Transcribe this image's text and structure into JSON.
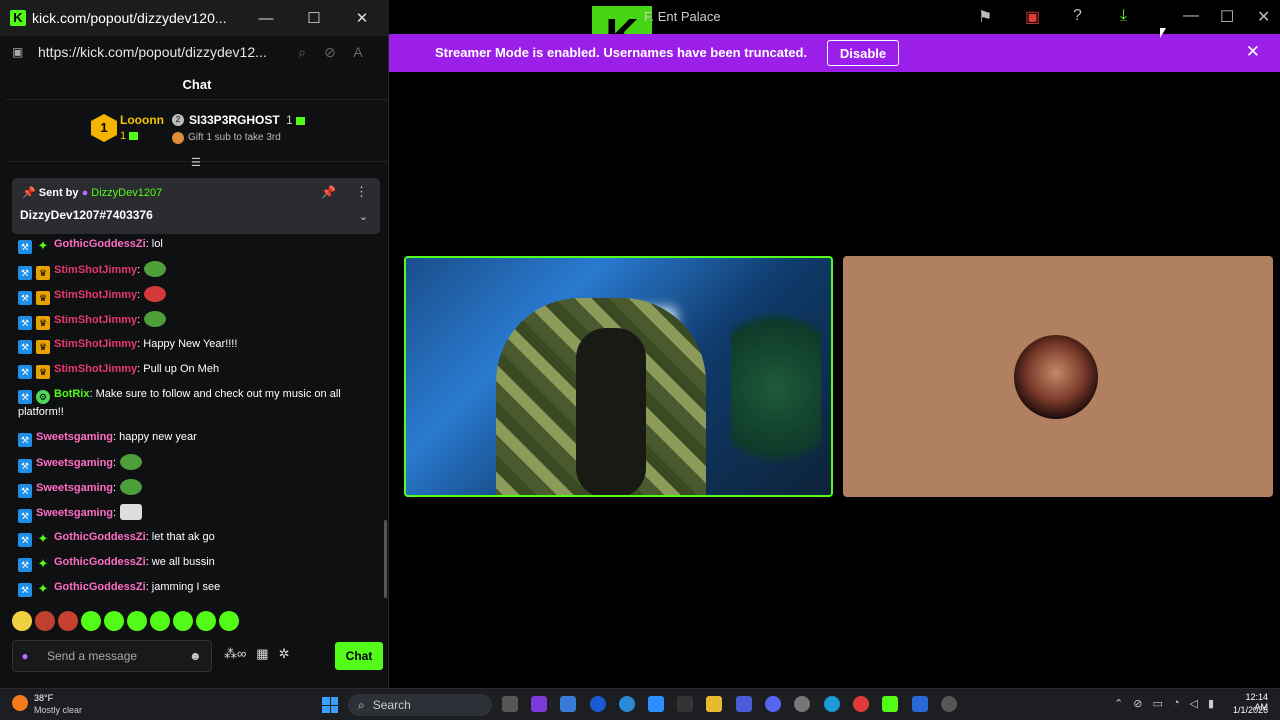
{
  "popout": {
    "title": "kick.com/popout/dizzydev120...",
    "url": "https://kick.com/popout/dizzydev12...",
    "chat_header": "Chat",
    "leaderboard": {
      "first_rank": "1",
      "first_name": "Looonn",
      "first_count": "1",
      "second_name": "SI33P3RGHOST",
      "second_count": "1",
      "gift_text": "Gift 1 sub to take 3rd"
    },
    "pinned": {
      "sent_by_label": "Sent by",
      "sender": "DizzyDev1207",
      "message": "DizzyDev1207#7403376"
    },
    "messages": [
      {
        "badges": [
          "tool",
          "spark"
        ],
        "user": "GothicGoddessZi",
        "color": "#ff6ec7",
        "text": ": lol"
      },
      {
        "badges": [
          "tool",
          "crown"
        ],
        "user": "StimShotJimmy",
        "color": "#e6396b",
        "text": ":",
        "emote": "green"
      },
      {
        "badges": [
          "tool",
          "crown"
        ],
        "user": "StimShotJimmy",
        "color": "#e6396b",
        "text": ":",
        "emote": "red"
      },
      {
        "badges": [
          "tool",
          "crown"
        ],
        "user": "StimShotJimmy",
        "color": "#e6396b",
        "text": ":",
        "emote": "green"
      },
      {
        "badges": [
          "tool",
          "crown"
        ],
        "user": "StimShotJimmy",
        "color": "#e6396b",
        "text": ": Happy New Year!!!!"
      },
      {
        "badges": [
          "tool",
          "crown"
        ],
        "user": "StimShotJimmy",
        "color": "#e6396b",
        "text": ": Pull up On Meh"
      },
      {
        "badges": [
          "tool",
          "bot"
        ],
        "user": "BotRix",
        "color": "#53fc18",
        "text": ": Make sure to follow and check out my music on all platform!!"
      },
      {
        "badges": [
          "tool"
        ],
        "user": "Sweetsgaming",
        "color": "#ff6ec7",
        "text": ": happy new year"
      },
      {
        "badges": [
          "tool"
        ],
        "user": "Sweetsgaming",
        "color": "#ff6ec7",
        "text": ":",
        "emote": "green"
      },
      {
        "badges": [
          "tool"
        ],
        "user": "Sweetsgaming",
        "color": "#ff6ec7",
        "text": ":",
        "emote": "green"
      },
      {
        "badges": [
          "tool"
        ],
        "user": "Sweetsgaming",
        "color": "#ff6ec7",
        "text": ":",
        "emote": "cat"
      },
      {
        "badges": [
          "tool",
          "spark"
        ],
        "user": "GothicGoddessZi",
        "color": "#ff6ec7",
        "text": ": let that ak go"
      },
      {
        "badges": [
          "tool",
          "spark"
        ],
        "user": "GothicGoddessZi",
        "color": "#ff6ec7",
        "text": ": we all bussin"
      },
      {
        "badges": [
          "tool",
          "spark"
        ],
        "user": "GothicGoddessZi",
        "color": "#ff6ec7",
        "text": ": jamming I see"
      }
    ],
    "emote_bar": [
      "#f0d040",
      "#c04030",
      "#c84030",
      "#53fc18",
      "#53fc18",
      "#53fc18",
      "#53fc18",
      "#53fc18",
      "#53fc18",
      "#53fc18"
    ],
    "input_placeholder": "Send a message",
    "chat_button": "Chat"
  },
  "main": {
    "title": "F. Ent Palace",
    "logo_text": "K",
    "banner_text": "Streamer Mode is enabled. Usernames have been truncated.",
    "disable_button": "Disable",
    "accent": "#53fc18",
    "banner_color": "#9b1fe8"
  },
  "taskbar": {
    "temperature": "38°F",
    "condition": "Mostly clear",
    "search_placeholder": "Search",
    "time": "12:14 AM",
    "date": "1/1/2026"
  }
}
